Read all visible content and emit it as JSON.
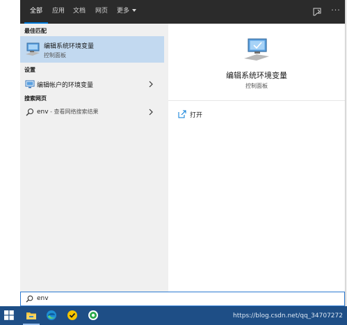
{
  "tabs": [
    {
      "label": "全部"
    },
    {
      "label": "应用"
    },
    {
      "label": "文档"
    },
    {
      "label": "网页"
    },
    {
      "label": "更多"
    }
  ],
  "left": {
    "best_match_heading": "最佳匹配",
    "best_match": {
      "title": "编辑系统环境变量",
      "subtitle": "控制面板",
      "icon": "system-properties-icon"
    },
    "settings_heading": "设置",
    "settings_item": {
      "label": "编辑帐户的环境变量",
      "icon": "settings-monitor-icon"
    },
    "web_heading": "搜索网页",
    "web_item": {
      "query": "env",
      "suffix": " - 查看网络搜索结果",
      "icon": "search-icon"
    }
  },
  "right": {
    "title": "编辑系统环境变量",
    "subtitle": "控制面板",
    "open_label": "打开"
  },
  "search": {
    "value": "env"
  },
  "taskbar": {
    "apps": [
      "file-explorer-icon",
      "edge-icon",
      "norton-icon",
      "app-icon"
    ],
    "watermark": "https://blog.csdn.net/qq_34707272"
  },
  "colors": {
    "accent": "#0078d7",
    "selection": "#c2d9f0",
    "taskbar": "#1e4e86",
    "topbar": "#2b2b2b"
  }
}
